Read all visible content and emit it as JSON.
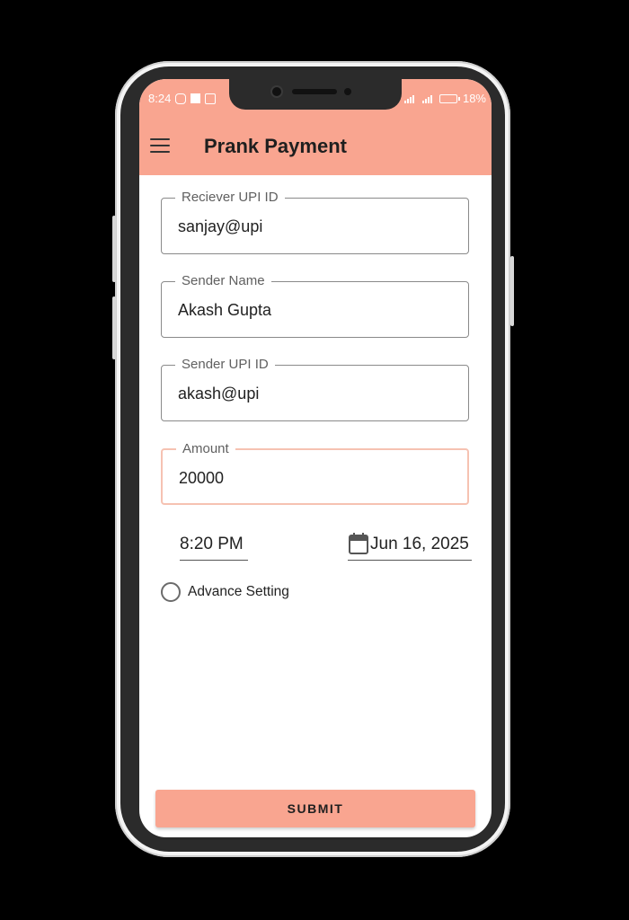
{
  "status_bar": {
    "time": "8:24",
    "battery": "18%",
    "icons": [
      "instagram-icon",
      "square-icon",
      "gallery-icon",
      "wifi-icon",
      "signal-icon",
      "battery-icon"
    ]
  },
  "app_bar": {
    "title": "Prank Payment",
    "menu_icon": "hamburger-menu-icon"
  },
  "form": {
    "receiver_upi": {
      "label": "Reciever UPI ID",
      "value": "sanjay@upi"
    },
    "sender_name": {
      "label": "Sender Name",
      "value": "Akash Gupta"
    },
    "sender_upi": {
      "label": "Sender UPI ID",
      "value": "akash@upi"
    },
    "amount": {
      "label": "Amount",
      "value": "20000"
    },
    "time": "8:20 PM",
    "date": "Jun 16, 2025",
    "advance_setting": "Advance Setting",
    "submit": "SUBMIT"
  },
  "colors": {
    "accent": "#f9a590",
    "active_border": "#f6c2b2",
    "background": "#000000"
  }
}
